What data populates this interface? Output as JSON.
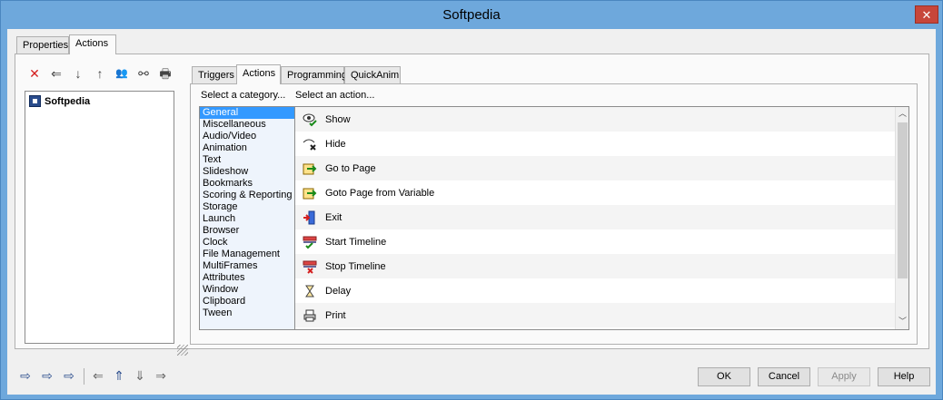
{
  "window": {
    "title": "Softpedia",
    "close_label": "✕"
  },
  "outer_tabs": [
    "Properties",
    "Actions"
  ],
  "left_toolbar": [
    {
      "name": "delete-icon",
      "glyph": "✕"
    },
    {
      "name": "arrow-left-icon",
      "glyph": "⇐"
    },
    {
      "name": "arrow-down-icon",
      "glyph": "↓"
    },
    {
      "name": "arrow-up-icon",
      "glyph": "↑"
    },
    {
      "name": "users-icon",
      "glyph": "👥"
    },
    {
      "name": "link-icon",
      "glyph": "⚯"
    },
    {
      "name": "print-icon",
      "glyph": "🖶"
    }
  ],
  "tree": {
    "root_label": "Softpedia"
  },
  "inner_tabs": [
    "Triggers",
    "Actions",
    "Programming",
    "QuickAnim"
  ],
  "labels": {
    "category": "Select a category...",
    "action": "Select an action..."
  },
  "categories": [
    "General",
    "Miscellaneous",
    "Audio/Video",
    "Animation",
    "Text",
    "Slideshow",
    "Bookmarks",
    "Scoring & Reporting",
    "Storage",
    "Launch",
    "Browser",
    "Clock",
    "File Management",
    "MultiFrames",
    "Attributes",
    "Window",
    "Clipboard",
    "Tween"
  ],
  "actions": [
    {
      "label": "Show",
      "icon": "eye-check-icon"
    },
    {
      "label": "Hide",
      "icon": "eye-cross-icon"
    },
    {
      "label": "Go to Page",
      "icon": "go-page-icon"
    },
    {
      "label": "Goto Page from Variable",
      "icon": "go-page-variable-icon"
    },
    {
      "label": "Exit",
      "icon": "exit-door-icon"
    },
    {
      "label": "Start Timeline",
      "icon": "timeline-start-icon"
    },
    {
      "label": "Stop Timeline",
      "icon": "timeline-stop-icon"
    },
    {
      "label": "Delay",
      "icon": "hourglass-icon"
    },
    {
      "label": "Print",
      "icon": "printer-icon"
    }
  ],
  "bottom_toolbar": [
    {
      "name": "import-icon",
      "glyph": "⇨"
    },
    {
      "name": "export-icon",
      "glyph": "⇨"
    },
    {
      "name": "copy-icon",
      "glyph": "⇨"
    },
    {
      "name": "arrow-left-icon",
      "glyph": "⇐"
    },
    {
      "name": "arrow-up-icon",
      "glyph": "⇑"
    },
    {
      "name": "arrow-down-icon",
      "glyph": "⇓"
    },
    {
      "name": "arrow-right-icon",
      "glyph": "⇒"
    }
  ],
  "buttons": {
    "ok": "OK",
    "cancel": "Cancel",
    "apply": "Apply",
    "help": "Help"
  }
}
